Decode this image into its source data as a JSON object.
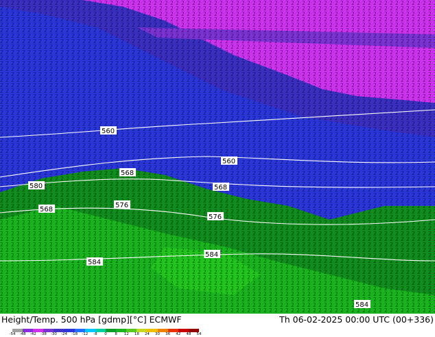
{
  "map": {
    "title": "Height/Temp. 500 hPa [gdmp][°C] ECMWF",
    "valid_time": "Th 06-02-2025 00:00 UTC (00+336)",
    "contour_labels": [
      "560",
      "560",
      "568",
      "580",
      "568",
      "568",
      "576",
      "576",
      "584",
      "584",
      "584"
    ],
    "colorbar_ticks": [
      "-54",
      "-48",
      "-42",
      "-38",
      "-30",
      "-24",
      "-18",
      "-12",
      "-8",
      "0",
      "8",
      "12",
      "18",
      "24",
      "30",
      "36",
      "42",
      "48",
      "54"
    ],
    "colors": {
      "very_cold": "#cc33ee",
      "cold": "#5b3fc8",
      "cool": "#2a36d8",
      "cool_light": "#1e5be0",
      "mild": "#118c1e",
      "warm": "#19b41f",
      "warm_light": "#22c51e",
      "contour": "#ffffff"
    },
    "colorbar_colors": [
      "#a0a0a0",
      "#8a2be2",
      "#cc33ee",
      "#7a32d2",
      "#4035c8",
      "#2a36d8",
      "#1f70ff",
      "#00c8ff",
      "#00d0a0",
      "#0a9e28",
      "#19b41f",
      "#5ac81e",
      "#c8d81e",
      "#f0c000",
      "#f08000",
      "#e83000",
      "#c80000",
      "#900000"
    ]
  }
}
